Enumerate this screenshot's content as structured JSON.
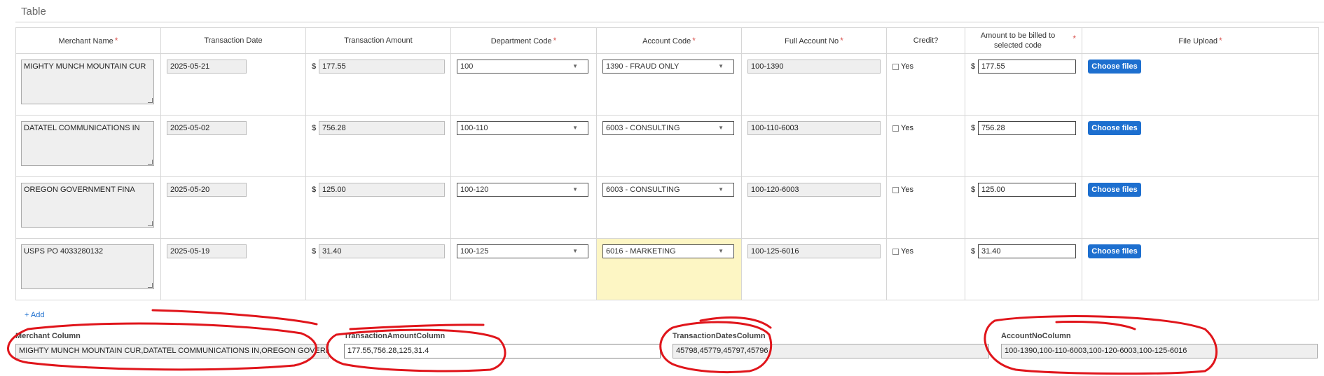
{
  "section": {
    "title": "Table"
  },
  "table": {
    "headers": [
      {
        "label": "Merchant Name",
        "required": "*"
      },
      {
        "label": "Transaction Date",
        "required": ""
      },
      {
        "label": "Transaction Amount",
        "required": ""
      },
      {
        "label": "Department Code",
        "required": "*"
      },
      {
        "label": "Account Code",
        "required": "*"
      },
      {
        "label": "Full Account No",
        "required": "*"
      },
      {
        "label": "Credit?",
        "required": ""
      },
      {
        "label": "Amount to be billed to selected code",
        "required": "*"
      },
      {
        "label": "File Upload",
        "required": "*"
      }
    ],
    "currency_symbol": "$",
    "credit_label": "Yes",
    "choose_files_label": "Choose files",
    "rows": [
      {
        "merchant": "MIGHTY MUNCH MOUNTAIN CUR",
        "date": "2025-05-21",
        "amount": "177.55",
        "dept": "100",
        "account": "1390 - FRAUD ONLY",
        "full_account": "100-1390",
        "billed": "177.55"
      },
      {
        "merchant": "DATATEL COMMUNICATIONS IN",
        "date": "2025-05-02",
        "amount": "756.28",
        "dept": "100-110",
        "account": "6003 - CONSULTING",
        "full_account": "100-110-6003",
        "billed": "756.28"
      },
      {
        "merchant": "OREGON GOVERNMENT FINA",
        "date": "2025-05-20",
        "amount": "125.00",
        "dept": "100-120",
        "account": "6003 - CONSULTING",
        "full_account": "100-120-6003",
        "billed": "125.00"
      },
      {
        "merchant": "USPS PO 4033280132",
        "date": "2025-05-19",
        "amount": "31.40",
        "dept": "100-125",
        "account": "6016 - MARKETING",
        "full_account": "100-125-6016",
        "billed": "31.40"
      }
    ]
  },
  "add_link": "+ Add",
  "summary_fields": {
    "merchant_column": {
      "label": "Merchant Column",
      "value": "MIGHTY MUNCH MOUNTAIN CUR,DATATEL COMMUNICATIONS IN,OREGON GOVERNMENT"
    },
    "transaction_amount_column": {
      "label": "TransactionAmountColumn",
      "value": "177.55,756.28,125,31.4"
    },
    "transaction_dates_column": {
      "label": "TransactionDatesColumn",
      "value": "45798,45779,45797,45796"
    },
    "account_no_column": {
      "label": "AccountNoColumn",
      "value": "100-1390,100-110-6003,100-120-6003,100-125-6016"
    }
  },
  "colors": {
    "required_asterisk": "#d9534f",
    "button_blue": "#1d6fcf",
    "highlight_cell": "#fdf6c4",
    "annotation_red": "#e0151b"
  },
  "icons": {
    "select_caret": "▼"
  }
}
